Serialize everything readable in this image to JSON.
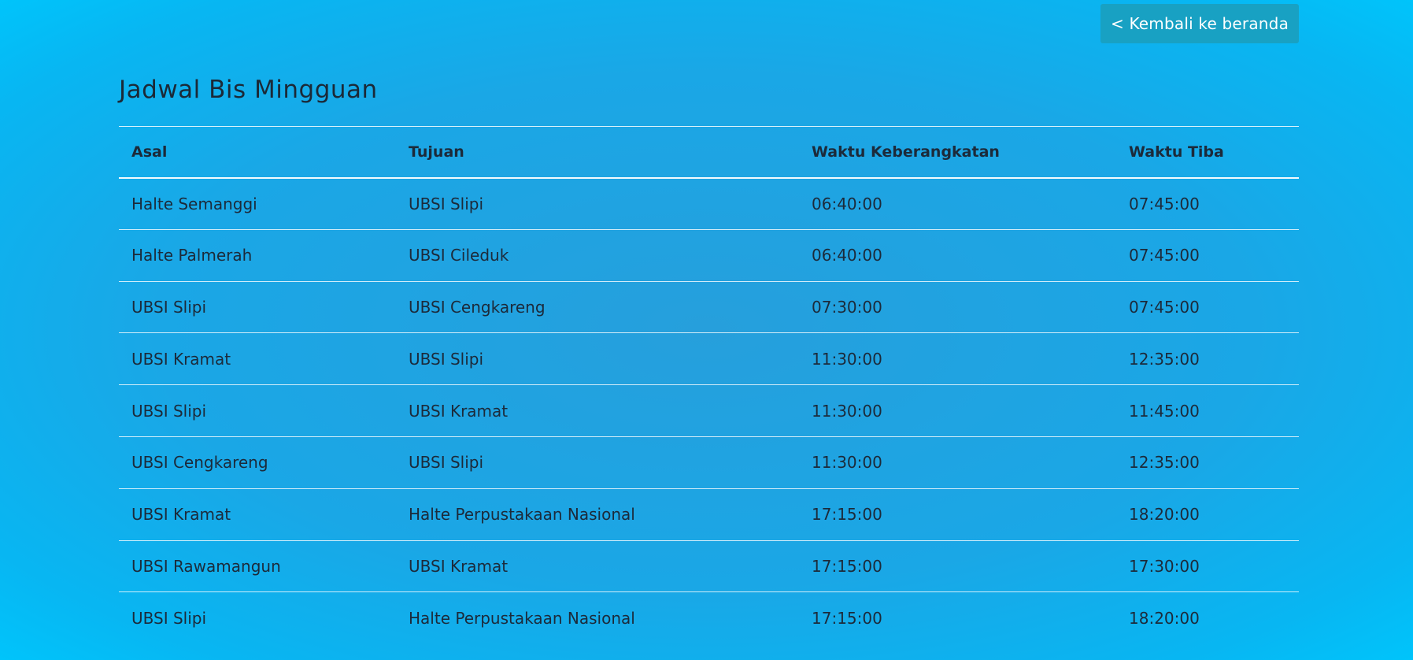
{
  "nav": {
    "back_label": "< Kembali ke beranda"
  },
  "page": {
    "title": "Jadwal Bis Mingguan"
  },
  "table": {
    "headers": [
      "Asal",
      "Tujuan",
      "Waktu Keberangkatan",
      "Waktu Tiba"
    ],
    "rows": [
      [
        "Halte Semanggi",
        "UBSI Slipi",
        "06:40:00",
        "07:45:00"
      ],
      [
        "Halte Palmerah",
        "UBSI Cileduk",
        "06:40:00",
        "07:45:00"
      ],
      [
        "UBSI Slipi",
        "UBSI Cengkareng",
        "07:30:00",
        "07:45:00"
      ],
      [
        "UBSI Kramat",
        "UBSI Slipi",
        "11:30:00",
        "12:35:00"
      ],
      [
        "UBSI Slipi",
        "UBSI Kramat",
        "11:30:00",
        "11:45:00"
      ],
      [
        "UBSI Cengkareng",
        "UBSI Slipi",
        "11:30:00",
        "12:35:00"
      ],
      [
        "UBSI Kramat",
        "Halte Perpustakaan Nasional",
        "17:15:00",
        "18:20:00"
      ],
      [
        "UBSI Rawamangun",
        "UBSI Kramat",
        "17:15:00",
        "17:30:00"
      ],
      [
        "UBSI Slipi",
        "Halte Perpustakaan Nasional",
        "17:15:00",
        "18:20:00"
      ]
    ]
  },
  "colors": {
    "background": "#1aa7e6",
    "button": "#18a1c3",
    "text": "#1c2a3a"
  }
}
